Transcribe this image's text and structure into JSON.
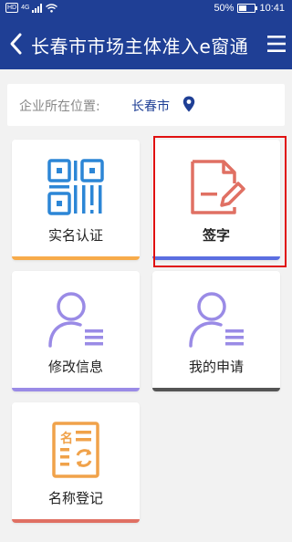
{
  "status_bar": {
    "hd": "HD",
    "signal": "4G",
    "battery": "50%",
    "battery_level": 0.5,
    "time": "10:41"
  },
  "header": {
    "title": "长春市市场主体准入e窗通",
    "back_icon": "chevron-left-icon",
    "menu_icon": "hamburger-menu-icon"
  },
  "location": {
    "label": "企业所在位置:",
    "city": "长春市",
    "pin_icon": "location-pin-icon"
  },
  "services": [
    {
      "label": "实名认证",
      "icon": "qr-code-icon",
      "bar_color": "#f7ab4b"
    },
    {
      "label": "签字",
      "icon": "document-pen-icon",
      "bar_color": "#5b6ee1",
      "highlighted": true
    },
    {
      "label": "修改信息",
      "icon": "user-list-icon",
      "bar_color": "#9a8be6"
    },
    {
      "label": "我的申请",
      "icon": "user-list-icon",
      "bar_color": "#555555"
    },
    {
      "label": "名称登记",
      "icon": "name-register-icon",
      "bar_color": "#e07063"
    }
  ],
  "colors": {
    "header": "#1f3f95",
    "accent_blue": "#2c86d6",
    "accent_red": "#e07063",
    "accent_purple": "#9a8be6",
    "accent_orange": "#f0a24a"
  }
}
